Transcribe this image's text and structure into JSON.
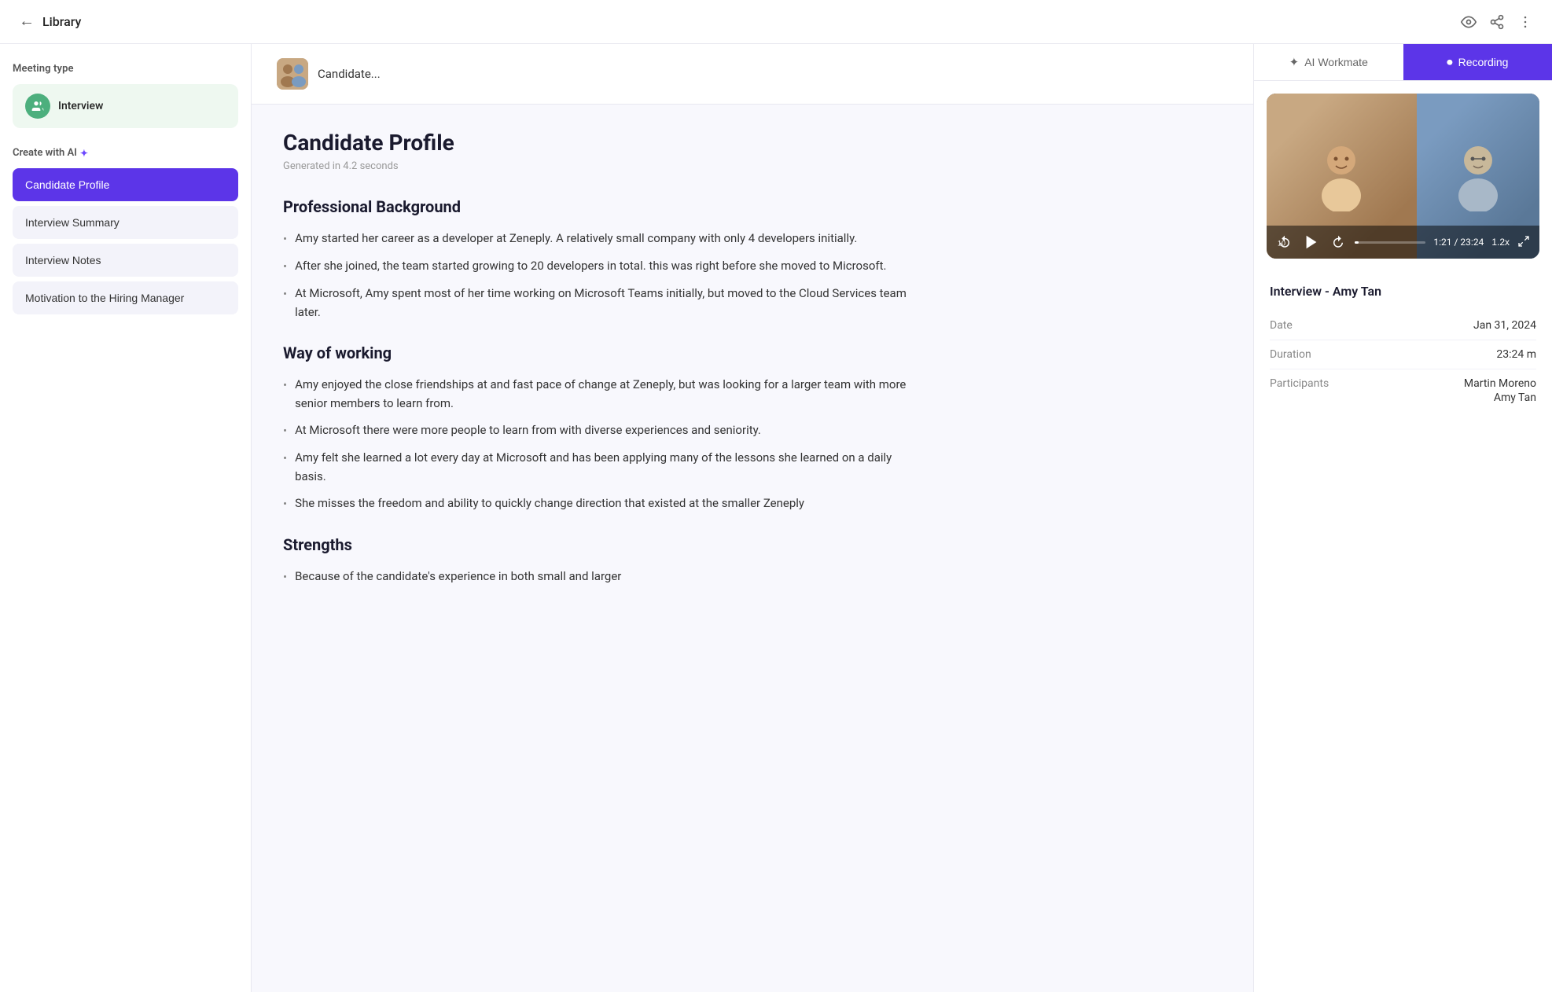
{
  "header": {
    "back_label": "←",
    "title": "Library",
    "icon_eye": "👁",
    "icon_share": "⬆",
    "icon_more": "⋮"
  },
  "candidate": {
    "name": "Candidate...",
    "avatar_emoji": "👩‍💼"
  },
  "sidebar": {
    "meeting_type_label": "Meeting type",
    "meeting_type": "Interview",
    "create_ai_label": "Create with AI",
    "nav_items": [
      {
        "id": "candidate-profile",
        "label": "Candidate Profile",
        "active": true
      },
      {
        "id": "interview-summary",
        "label": "Interview Summary",
        "active": false
      },
      {
        "id": "interview-notes",
        "label": "Interview Notes",
        "active": false
      },
      {
        "id": "motivation",
        "label": "Motivation to the Hiring Manager",
        "active": false
      }
    ]
  },
  "article": {
    "title": "Candidate Profile",
    "meta": "Generated in 4.2 seconds",
    "sections": [
      {
        "heading": "Professional Background",
        "bullets": [
          "Amy started her career as a developer at Zeneply. A relatively small company with only 4 developers initially.",
          "After she joined, the team started growing to 20 developers in total. this was right before she moved to Microsoft.",
          "At Microsoft, Amy spent most of her time working on Microsoft Teams initially, but moved to the Cloud Services team later."
        ]
      },
      {
        "heading": "Way of working",
        "bullets": [
          "Amy enjoyed the close friendships at and fast pace of change at Zeneply, but was looking for a larger team with more senior members to learn from.",
          "At Microsoft there were more people to learn from with diverse experiences and seniority.",
          "Amy felt she learned a lot every day at Microsoft and has been applying many of the lessons she learned on a daily basis.",
          "She misses the freedom and ability to quickly change direction that existed at the smaller Zeneply"
        ]
      },
      {
        "heading": "Strengths",
        "bullets": [
          "Because of the candidate's experience in both small and larger"
        ]
      }
    ]
  },
  "right_panel": {
    "tabs": [
      {
        "id": "ai-workmate",
        "label": "AI Workmate",
        "icon": "✦",
        "active": false
      },
      {
        "id": "recording",
        "label": "Recording",
        "icon": "⏺",
        "active": true
      }
    ],
    "video": {
      "time_current": "1:21",
      "time_total": "23:24",
      "speed": "1.2x"
    },
    "interview": {
      "title": "Interview - Amy Tan",
      "date_label": "Date",
      "date_value": "Jan 31, 2024",
      "duration_label": "Duration",
      "duration_value": "23:24 m",
      "participants_label": "Participants",
      "participant1": "Martin Moreno",
      "participant2": "Amy Tan"
    }
  }
}
